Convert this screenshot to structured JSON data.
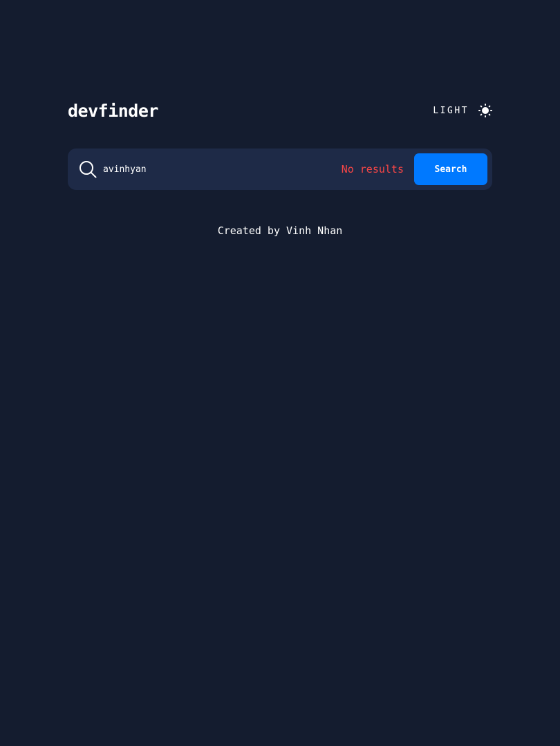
{
  "app": {
    "logo": "devfinder"
  },
  "theme_toggle": {
    "label": "LIGHT",
    "icon": "sun-icon"
  },
  "search": {
    "icon": "search-icon",
    "value": "avinhyan",
    "error_text": "No results",
    "button_label": "Search"
  },
  "footer": {
    "text": "Created by Vinh Nhan"
  },
  "colors": {
    "background": "#141C2F",
    "search_bar": "#1E2A47",
    "accent": "#0079FF",
    "error": "#F74646",
    "text": "#FFFFFF"
  }
}
